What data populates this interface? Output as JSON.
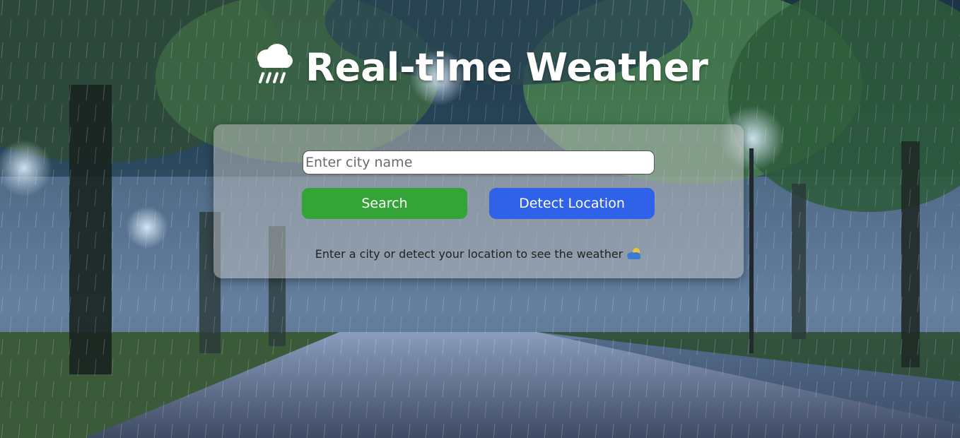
{
  "header": {
    "title": "Real-time Weather",
    "icon": "cloud-with-rain-icon"
  },
  "search": {
    "placeholder": "Enter city name",
    "value": ""
  },
  "buttons": {
    "search_label": "Search",
    "detect_label": "Detect Location"
  },
  "status": {
    "message": "Enter a city or detect your location to see the weather",
    "icon": "sun-behind-cloud-icon"
  },
  "colors": {
    "search_button": "#34a338",
    "detect_button": "#2f62e8",
    "card_background": "rgba(190,190,190,0.52)"
  }
}
